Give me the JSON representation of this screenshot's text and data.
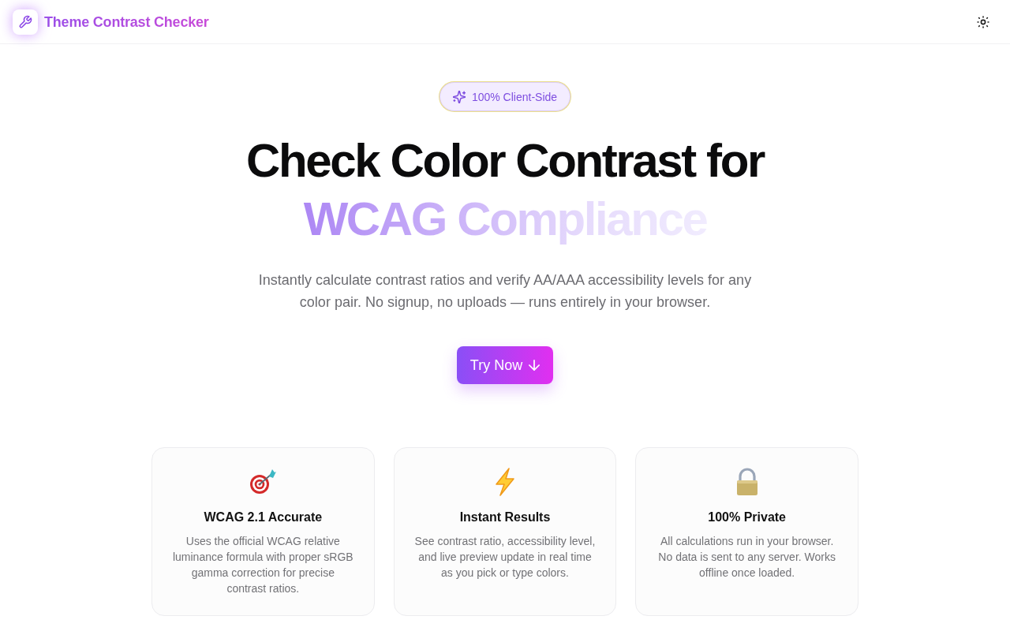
{
  "header": {
    "title": "Theme Contrast Checker"
  },
  "hero": {
    "badge": "100% Client-Side",
    "heading": "Check Color Contrast for",
    "heading_highlight": "WCAG Compliance",
    "description": "Instantly calculate contrast ratios and verify AA/AAA accessibility levels for any color pair. No signup, no uploads — runs entirely in your browser.",
    "cta": "Try Now"
  },
  "features": [
    {
      "title": "WCAG 2.1 Accurate",
      "description": "Uses the official WCAG relative luminance formula with proper sRGB gamma correction for precise contrast ratios."
    },
    {
      "title": "Instant Results",
      "description": "See contrast ratio, accessibility level, and live preview update in real time as you pick or type colors."
    },
    {
      "title": "100% Private",
      "description": "All calculations run in your browser. No data is sent to any server. Works offline once loaded."
    }
  ]
}
